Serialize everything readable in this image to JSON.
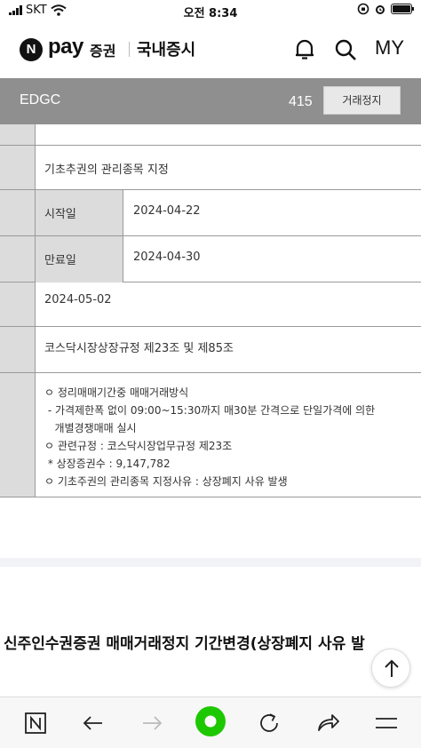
{
  "status_bar": {
    "carrier": "SKT",
    "time": "오전 8:34"
  },
  "header": {
    "logo_letter": "N",
    "logo_pay": "pay",
    "logo_stock": "증권",
    "section_title": "국내증시",
    "my_label": "MY"
  },
  "stock_bar": {
    "name": "EDGC",
    "price": "415",
    "status_button": "거래정지"
  },
  "table": {
    "designation": "기초추권의 관리종목 지정",
    "start_label": "시작일",
    "start_value": "2024-04-22",
    "end_label": "만료일",
    "end_value": "2024-04-30",
    "date_value": "2024-05-02",
    "regulation": "코스닥시장상장규정 제23조 및 제85조",
    "notes": [
      "ㅇ 정리매매기간중 매매거래방식",
      " - 가격제한폭 없이 09:00~15:30까지 매30분 간격으로 단일가격에 의한",
      "   개별경쟁매매 실시",
      "ㅇ 관련규정 : 코스닥시장업무규정 제23조",
      " * 상장증권수 : 9,147,782",
      "ㅇ 기초주권의 관리종목 지정사유 : 상장폐지 사유 발생"
    ]
  },
  "news": {
    "title": "신주인수권증권 매매거래정지 기간변경(상장폐지 사유 발"
  },
  "toolbar": {
    "home_letter": "N"
  }
}
